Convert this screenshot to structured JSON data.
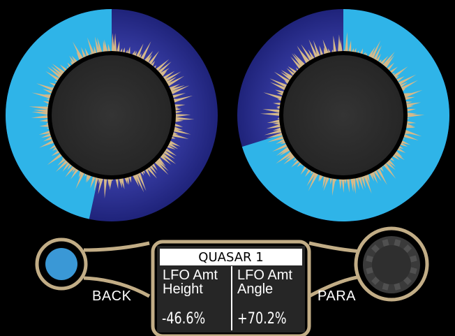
{
  "knobs": [
    {
      "id": "left",
      "value_fraction": -0.466
    },
    {
      "id": "right",
      "value_fraction": 0.702
    }
  ],
  "buttons": {
    "back_label": "BACK",
    "para_label": "PARA"
  },
  "screen": {
    "title": "QUASAR 1",
    "params": [
      {
        "name_line1": "LFO Amt",
        "name_line2": "Height",
        "value": "-46.6%"
      },
      {
        "name_line1": "LFO Amt",
        "name_line2": "Angle",
        "value": "+70.2%"
      }
    ]
  },
  "colors": {
    "background": "#000000",
    "ring_base": "#2b3191",
    "ring_dark": "#1c1f6b",
    "ring_accent": "#2fb4e8",
    "spike": "#d5b98a",
    "knob_body": "#2e2e2e",
    "frame": "#c2ad86",
    "back_button": "#3a98d6",
    "screen_bg": "#262626"
  }
}
